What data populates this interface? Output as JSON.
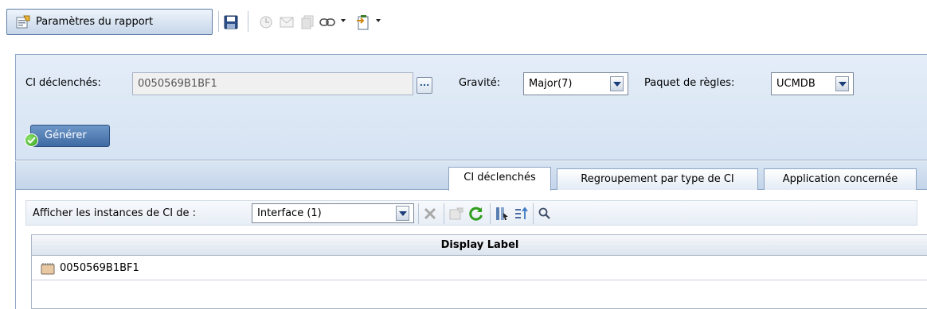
{
  "toolbar": {
    "report_params_label": "Paramètres du rapport",
    "icons": [
      "report-settings-icon",
      "save-icon",
      "schedule-icon",
      "email-icon",
      "copy-icon",
      "link-icon",
      "export-icon"
    ]
  },
  "filters": {
    "ci_label": "CI déclenchés:",
    "ci_value": "0050569B1BF1",
    "browse_label": "...",
    "severity_label": "Gravité:",
    "severity_value": "Major(7)",
    "rule_package_label": "Paquet de règles:",
    "rule_package_value": "UCMDB",
    "generate_label": "Générer"
  },
  "tabs": [
    {
      "label": "CI déclenchés",
      "active": true
    },
    {
      "label": "Regroupement par type de CI",
      "active": false
    },
    {
      "label": "Application concernée",
      "active": false
    }
  ],
  "instances": {
    "label": "Afficher les instances de CI de :",
    "selected": "Interface (1)"
  },
  "table": {
    "columns": [
      "Display Label"
    ],
    "rows": [
      {
        "label": "0050569B1BF1",
        "icon": "interface-ci-icon"
      }
    ]
  },
  "colors": {
    "accent": "#3f6aa3",
    "panel_bg": "#dce7f5",
    "tab_strip": "#c9d8ec",
    "refresh_green": "#2f9e1c"
  }
}
